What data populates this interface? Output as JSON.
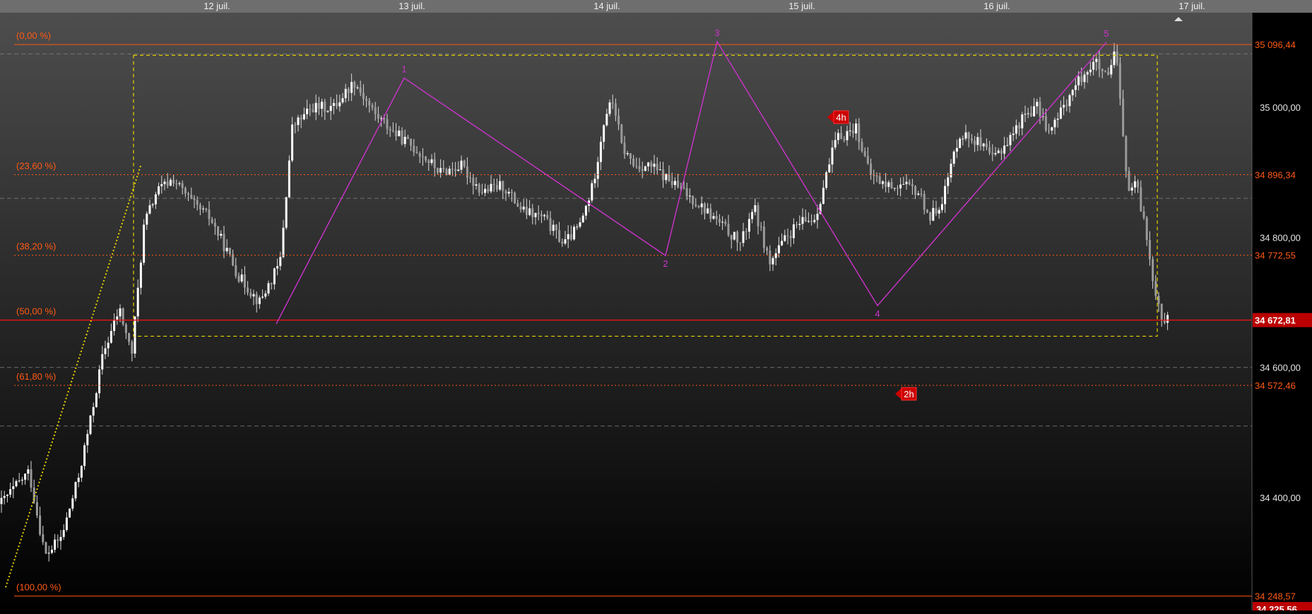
{
  "chart_data": {
    "type": "candlestick",
    "x_labels": [
      "12 juil.",
      "13 juil.",
      "14 juil.",
      "15 juil.",
      "16 juil.",
      "17 juil."
    ],
    "y_ticks": [
      {
        "value": 35000,
        "label": "35 000,00"
      },
      {
        "value": 34800,
        "label": "34 800,00"
      },
      {
        "value": 34600,
        "label": "34 600,00"
      },
      {
        "value": 34400,
        "label": "34 400,00"
      }
    ],
    "ylim": [
      34200,
      35150
    ],
    "fib_levels": [
      {
        "pct_label": "(0,00 %)",
        "value": 35096.44,
        "price_label": "35 096,44"
      },
      {
        "pct_label": "(23,60 %)",
        "value": 34896.34,
        "price_label": "34 896,34"
      },
      {
        "pct_label": "(38,20 %)",
        "value": 34772.55,
        "price_label": "34 772,55"
      },
      {
        "pct_label": "(50,00 %)",
        "value": 34672.81,
        "price_label": "34 672,81"
      },
      {
        "pct_label": "(61,80 %)",
        "value": 34572.46,
        "price_label": "34 572,46"
      },
      {
        "pct_label": "(100,00 %)",
        "value": 34248.57,
        "price_label": "34 248,57"
      }
    ],
    "last_price": {
      "value": 34672.81,
      "label": "34 672,81"
    },
    "bottom_price_label": "34 225,56",
    "wave_labels": [
      "1",
      "2",
      "3",
      "4",
      "5"
    ],
    "wave_points": [
      {
        "label": "",
        "x": 5.2,
        "y": 34667
      },
      {
        "label": "1",
        "x": 6.3,
        "y": 35045
      },
      {
        "label": "2",
        "x": 9.8,
        "y": 34772
      },
      {
        "label": "3",
        "x": 10.4,
        "y": 35101
      },
      {
        "label": "4",
        "x": 12.9,
        "y": 34695
      },
      {
        "label": "5",
        "x": 15.6,
        "y": 35100
      }
    ],
    "timeframe_flags": [
      {
        "label": "4h",
        "x": 11.9,
        "y": 34957
      },
      {
        "label": "2h",
        "x": 12.7,
        "y": 34549
      }
    ],
    "colors": {
      "fib": "#ff5a14",
      "last_price": "#ee1111",
      "wave": "#cc33cc",
      "box": "#e8d400",
      "trend": "#e8d400",
      "grid": "#8a8a8a",
      "candle": "#dcdcdc",
      "flag": "#cc0000"
    }
  }
}
